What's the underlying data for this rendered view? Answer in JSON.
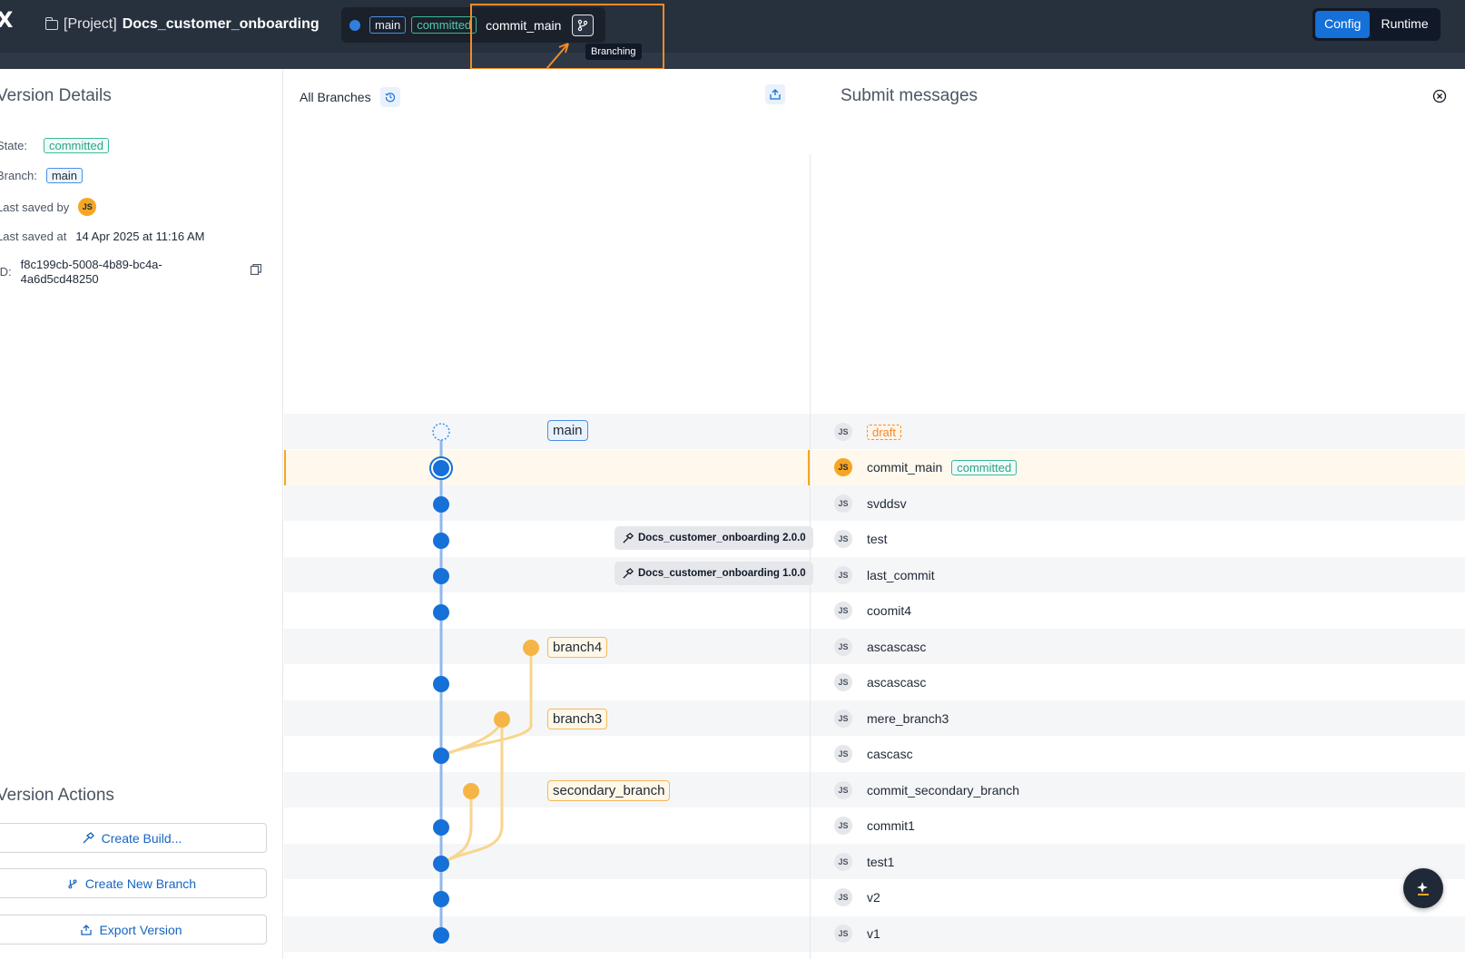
{
  "app": {
    "project_prefix": "[Project]",
    "project_name": "Docs_customer_onboarding"
  },
  "version_pill": {
    "branch": "main",
    "state": "committed",
    "commit": "commit_main",
    "branching_tooltip": "Branching"
  },
  "mode": {
    "config": "Config",
    "runtime": "Runtime",
    "active": "Config"
  },
  "version_details": {
    "title": "Version Details",
    "state_label": "State:",
    "state_value": "committed",
    "branch_label": "Branch:",
    "branch_value": "main",
    "saved_by_label": "Last saved by",
    "saved_by_initials": "JS",
    "saved_at_label": "Last saved at",
    "saved_at_value": "14 Apr 2025 at 11:16 AM",
    "id_label": "ID:",
    "id_line1": "f8c199cb-5008-4b89-bc4a-",
    "id_line2": "4a6d5cd48250"
  },
  "version_actions": {
    "title": "Version Actions",
    "create_build": "Create Build...",
    "create_branch": "Create New Branch",
    "export_version": "Export Version"
  },
  "graph": {
    "header": "All Branches",
    "branch_labels": {
      "main": "main",
      "branch4": "branch4",
      "branch3": "branch3",
      "secondary": "secondary_branch"
    },
    "builds": [
      "Docs_customer_onboarding 2.0.0",
      "Docs_customer_onboarding 1.0.0"
    ]
  },
  "messages": {
    "title": "Submit messages",
    "initials": "JS",
    "items": [
      {
        "text": "",
        "badge": "draft"
      },
      {
        "text": "commit_main",
        "badge": "committed"
      },
      {
        "text": "svddsv"
      },
      {
        "text": "test"
      },
      {
        "text": "last_commit"
      },
      {
        "text": "coomit4"
      },
      {
        "text": "ascascasc"
      },
      {
        "text": "ascascasc"
      },
      {
        "text": "mere_branch3"
      },
      {
        "text": "cascasc"
      },
      {
        "text": "commit_secondary_branch"
      },
      {
        "text": "commit1"
      },
      {
        "text": "test1"
      },
      {
        "text": "v2"
      },
      {
        "text": "v1"
      }
    ]
  },
  "colors": {
    "accent": "#1570d8",
    "branch_orange": "#f5b546",
    "main_blue": "#1570d8",
    "highlight": "#f28c28"
  }
}
